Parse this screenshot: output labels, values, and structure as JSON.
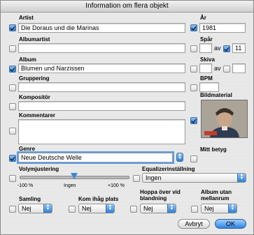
{
  "window": {
    "title": "Information om flera objekt"
  },
  "labels": {
    "artist": "Artist",
    "year": "År",
    "album_artist": "Albumartist",
    "track": "Spår",
    "album": "Album",
    "disc": "Skiva",
    "grouping": "Gruppering",
    "bpm": "BPM",
    "composer": "Kompositör",
    "artwork": "Bildmaterial",
    "comments": "Kommentarer",
    "genre": "Genre",
    "rating": "Mitt betyg",
    "volume": "Volymjustering",
    "equalizer": "Equalizerinställning",
    "compilation": "Samling",
    "remember_position": "Kom ihåg plats",
    "skip_shuffle": "Hoppa över vid blandning",
    "gapless": "Album utan mellanrum",
    "of1": "av",
    "of2": "av"
  },
  "fields": {
    "artist": "Die Doraus und die Marinas",
    "year": "1981",
    "album_artist": "",
    "track_number": "",
    "track_count": "11",
    "album": "Blumen und Narzissen",
    "disc_number": "",
    "disc_count": "",
    "grouping": "",
    "bpm": "",
    "composer": "",
    "comments": "",
    "genre": "Neue Deutsche Welle"
  },
  "checkboxes": {
    "artist": true,
    "year": true,
    "album_artist": false,
    "track_number": false,
    "track_count": true,
    "album": true,
    "disc_number": false,
    "disc_count": false,
    "grouping": false,
    "bpm": false,
    "composer": false,
    "comments": false,
    "artwork": true,
    "genre": true,
    "rating": false,
    "volume": false,
    "equalizer": false,
    "compilation": false,
    "remember_position": false,
    "skip_shuffle": false,
    "gapless": false
  },
  "volume": {
    "min_label": "-100 %",
    "mid_label": "Ingen",
    "max_label": "+100 %",
    "value_percent": 0
  },
  "equalizer": {
    "value": "Ingen"
  },
  "selects": {
    "compilation": "Nej",
    "remember_position": "Nej",
    "skip_shuffle": "Nej",
    "gapless": "Nej"
  },
  "buttons": {
    "cancel": "Avbryt",
    "ok": "OK"
  },
  "colors": {
    "accent": "#2f7fd4",
    "focus_ring": "#5b9be6"
  }
}
